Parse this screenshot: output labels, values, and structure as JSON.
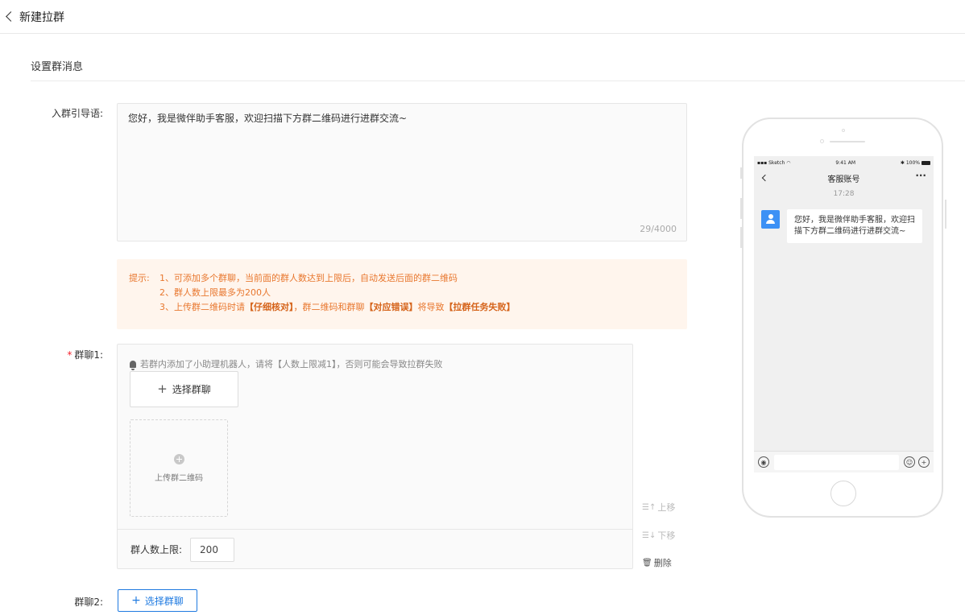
{
  "header": {
    "back_label": "新建拉群"
  },
  "section": {
    "title": "设置群消息"
  },
  "guide": {
    "label": "入群引导语:",
    "value": "您好，我是微伴助手客服，欢迎扫描下方群二维码进行进群交流~",
    "counter": "29/4000"
  },
  "tips": {
    "prefix": "提示:",
    "line1": "1、可添加多个群聊，当前面的群人数达到上限后，自动发送后面的群二维码",
    "line2": "2、群人数上限最多为200人",
    "line3_a": "3、上传群二维码时请",
    "line3_b": "【仔细核对】",
    "line3_c": "，群二维码和群聊",
    "line3_d": "【对应错误】",
    "line3_e": "将导致",
    "line3_f": "【拉群任务失败】"
  },
  "group1": {
    "required_mark": "*",
    "label": "群聊1:",
    "warning": "若群内添加了小助理机器人，请将【人数上限减1】，否则可能会导致拉群失败",
    "select_label": "选择群聊",
    "upload_label": "上传群二维码",
    "limit_label": "群人数上限:",
    "limit_value": "200",
    "move_up": "上移",
    "move_down": "下移",
    "delete": "删除"
  },
  "group2": {
    "label": "群聊2:",
    "select_label": "选择群聊"
  },
  "phone": {
    "carrier": "Sketch",
    "time": "9:41 AM",
    "battery": "100%",
    "nav_title": "客服账号",
    "more": "···",
    "chat_time": "17:28",
    "message": "您好，我是微伴助手客服，欢迎扫描下方群二维码进行进群交流~"
  },
  "colors": {
    "primary": "#1f7ae0",
    "tip_text": "#e8772e",
    "tip_bg": "#fff5ed",
    "required": "#f5222d",
    "avatar": "#3d91f5"
  }
}
